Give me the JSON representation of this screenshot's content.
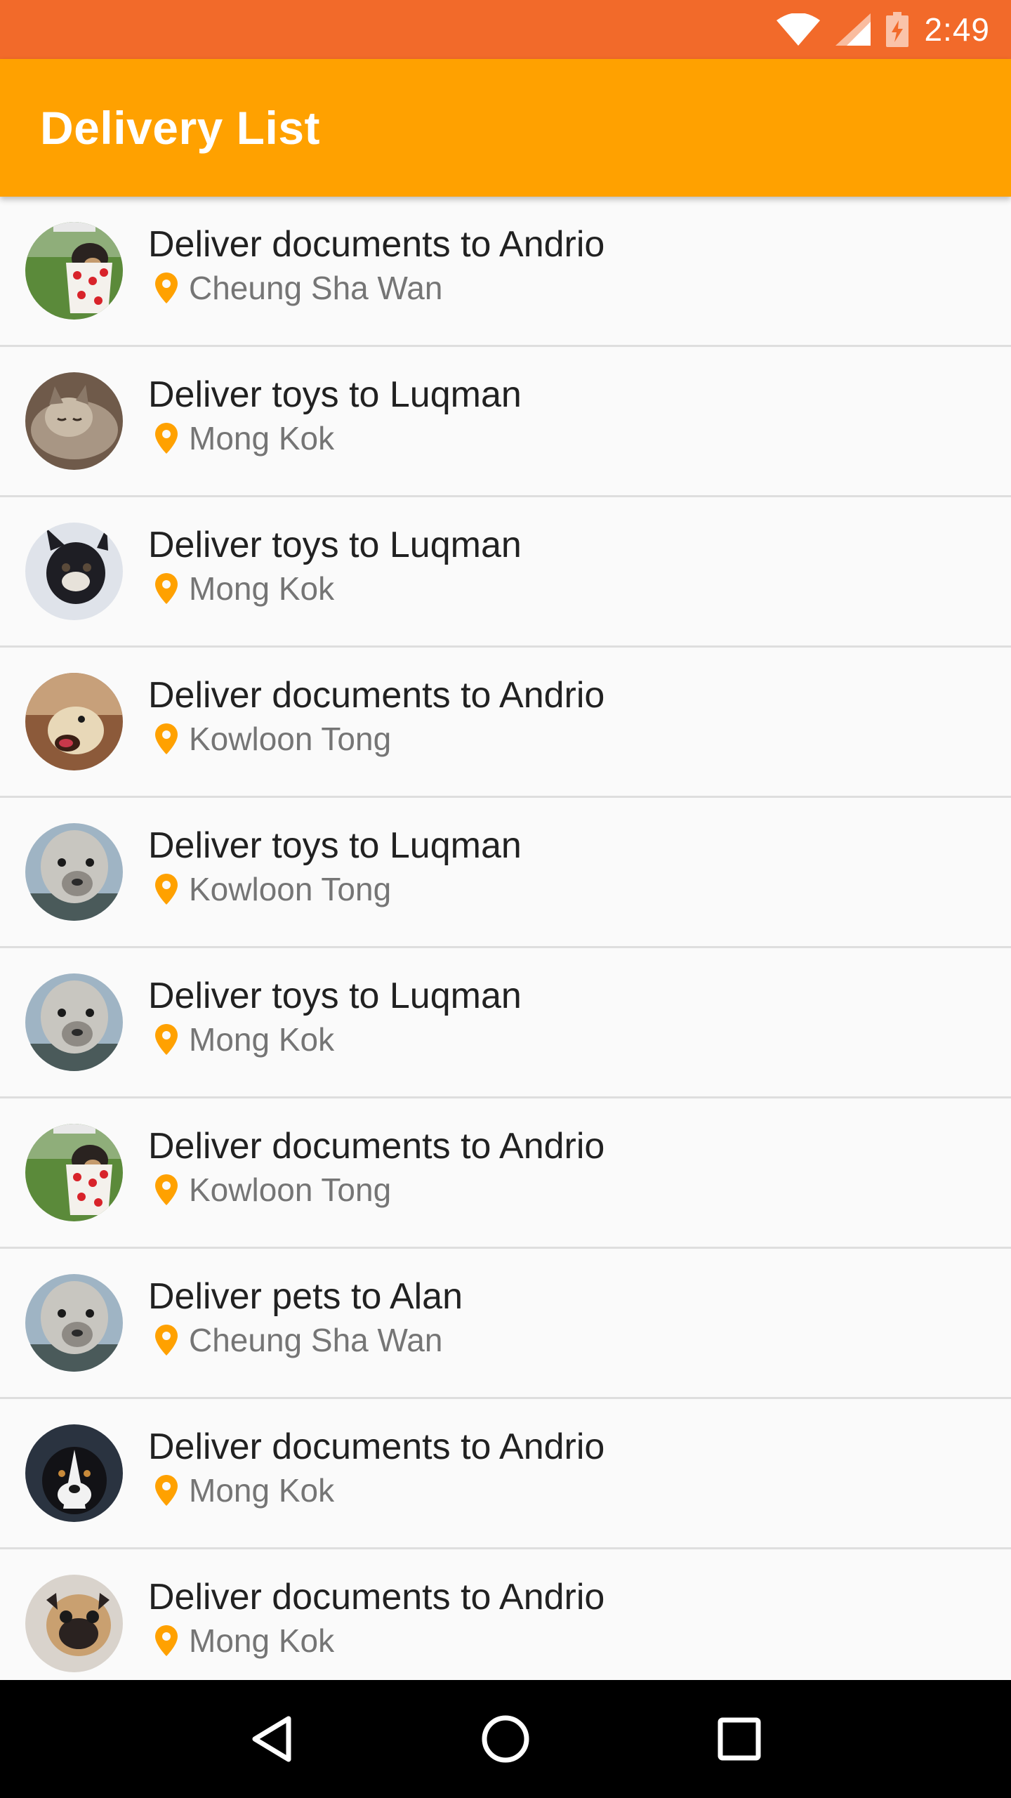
{
  "status_bar": {
    "time": "2:49",
    "icons": [
      "wifi-icon",
      "cell-signal-icon",
      "battery-charging-icon"
    ],
    "background": "#f26a2a"
  },
  "app_bar": {
    "title": "Delivery List",
    "background": "#ffa100"
  },
  "deliveries": [
    {
      "title": "Deliver documents to Andrio",
      "location": "Cheung Sha Wan",
      "avatar": "dog-in-polka-dot-mug"
    },
    {
      "title": "Deliver toys to Luqman",
      "location": "Mong Kok",
      "avatar": "sleeping-cat"
    },
    {
      "title": "Deliver toys to Luqman",
      "location": "Mong Kok",
      "avatar": "french-bulldog"
    },
    {
      "title": "Deliver documents to Andrio",
      "location": "Kowloon Tong",
      "avatar": "excited-goat"
    },
    {
      "title": "Deliver toys to Luqman",
      "location": "Kowloon Tong",
      "avatar": "alpaca"
    },
    {
      "title": "Deliver toys to Luqman",
      "location": "Mong Kok",
      "avatar": "alpaca"
    },
    {
      "title": "Deliver documents to Andrio",
      "location": "Kowloon Tong",
      "avatar": "dog-in-polka-dot-mug"
    },
    {
      "title": "Deliver pets to Alan",
      "location": "Cheung Sha Wan",
      "avatar": "alpaca"
    },
    {
      "title": "Deliver documents to Andrio",
      "location": "Mong Kok",
      "avatar": "border-collie"
    },
    {
      "title": "Deliver documents to Andrio",
      "location": "Mong Kok",
      "avatar": "pug"
    }
  ],
  "colors": {
    "pin": "#ffa100",
    "title_text": "#212121",
    "location_text": "#757575",
    "divider": "#dedede"
  },
  "nav_bar": {
    "buttons": [
      "back-icon",
      "home-icon",
      "recents-icon"
    ]
  }
}
